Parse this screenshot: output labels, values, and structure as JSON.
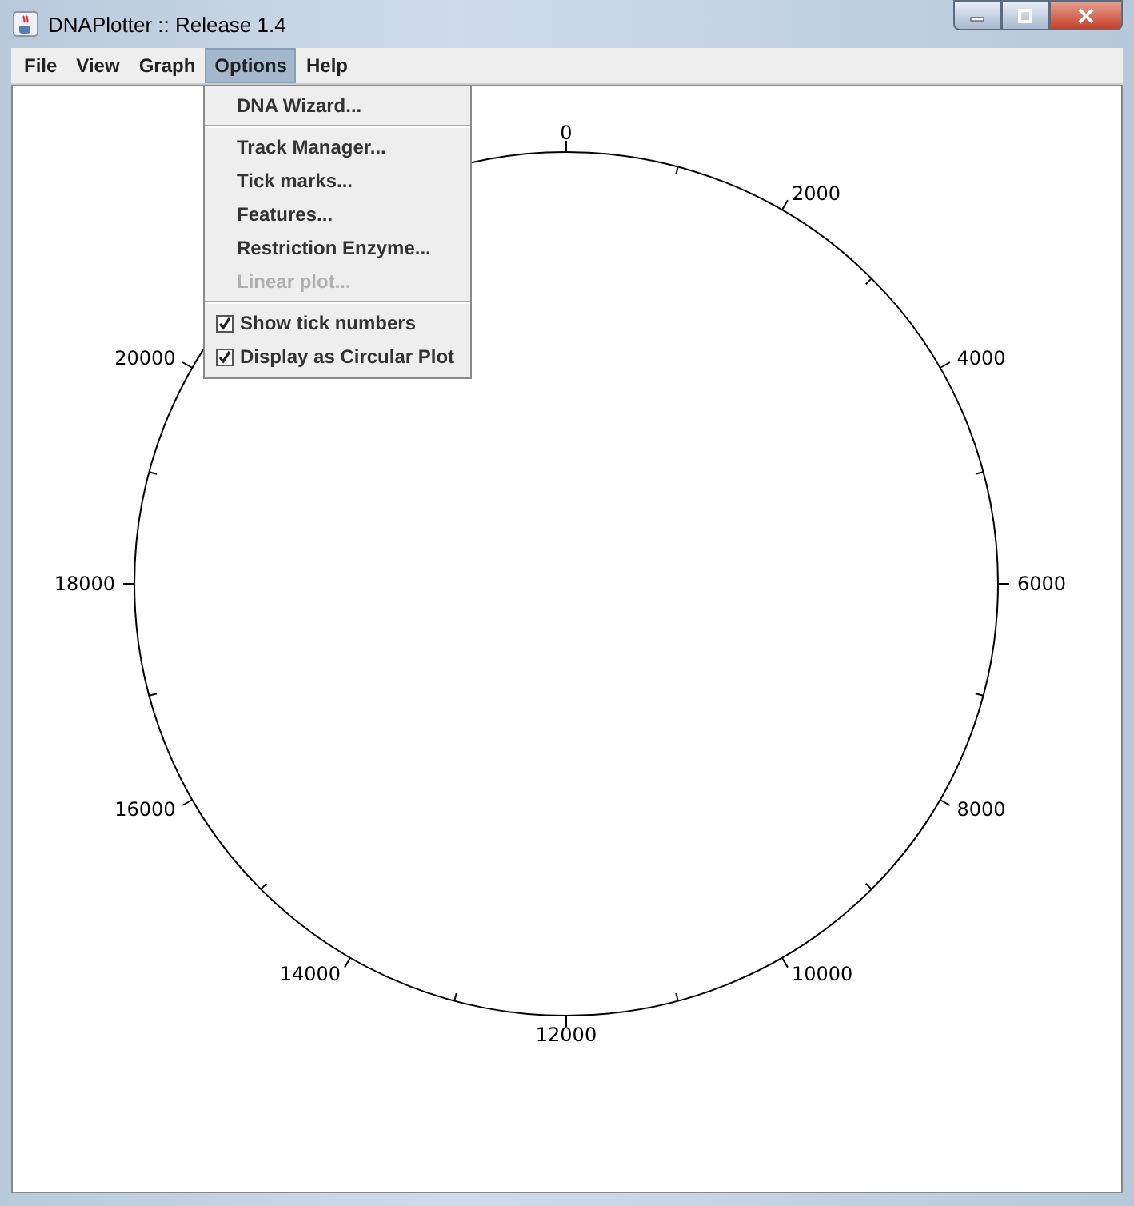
{
  "window": {
    "title": "DNAPlotter :: Release 1.4"
  },
  "menu_bar": [
    {
      "label": "File",
      "selected": false
    },
    {
      "label": "View",
      "selected": false
    },
    {
      "label": "Graph",
      "selected": false
    },
    {
      "label": "Options",
      "selected": true
    },
    {
      "label": "Help",
      "selected": false
    }
  ],
  "options_menu": [
    {
      "kind": "item",
      "label": "DNA Wizard...",
      "disabled": false
    },
    {
      "kind": "separator"
    },
    {
      "kind": "item",
      "label": "Track Manager...",
      "disabled": false
    },
    {
      "kind": "item",
      "label": "Tick marks...",
      "disabled": false
    },
    {
      "kind": "item",
      "label": "Features...",
      "disabled": false
    },
    {
      "kind": "item",
      "label": "Restriction Enzyme...",
      "disabled": false
    },
    {
      "kind": "item",
      "label": "Linear plot...",
      "disabled": true
    },
    {
      "kind": "separator"
    },
    {
      "kind": "check",
      "label": "Show tick numbers",
      "checked": true
    },
    {
      "kind": "check",
      "label": "Display as Circular Plot",
      "checked": true
    }
  ],
  "plot": {
    "tick_labels": [
      "0",
      "2000",
      "4000",
      "6000",
      "8000",
      "10000",
      "12000",
      "14000",
      "16000",
      "18000",
      "20000"
    ]
  }
}
